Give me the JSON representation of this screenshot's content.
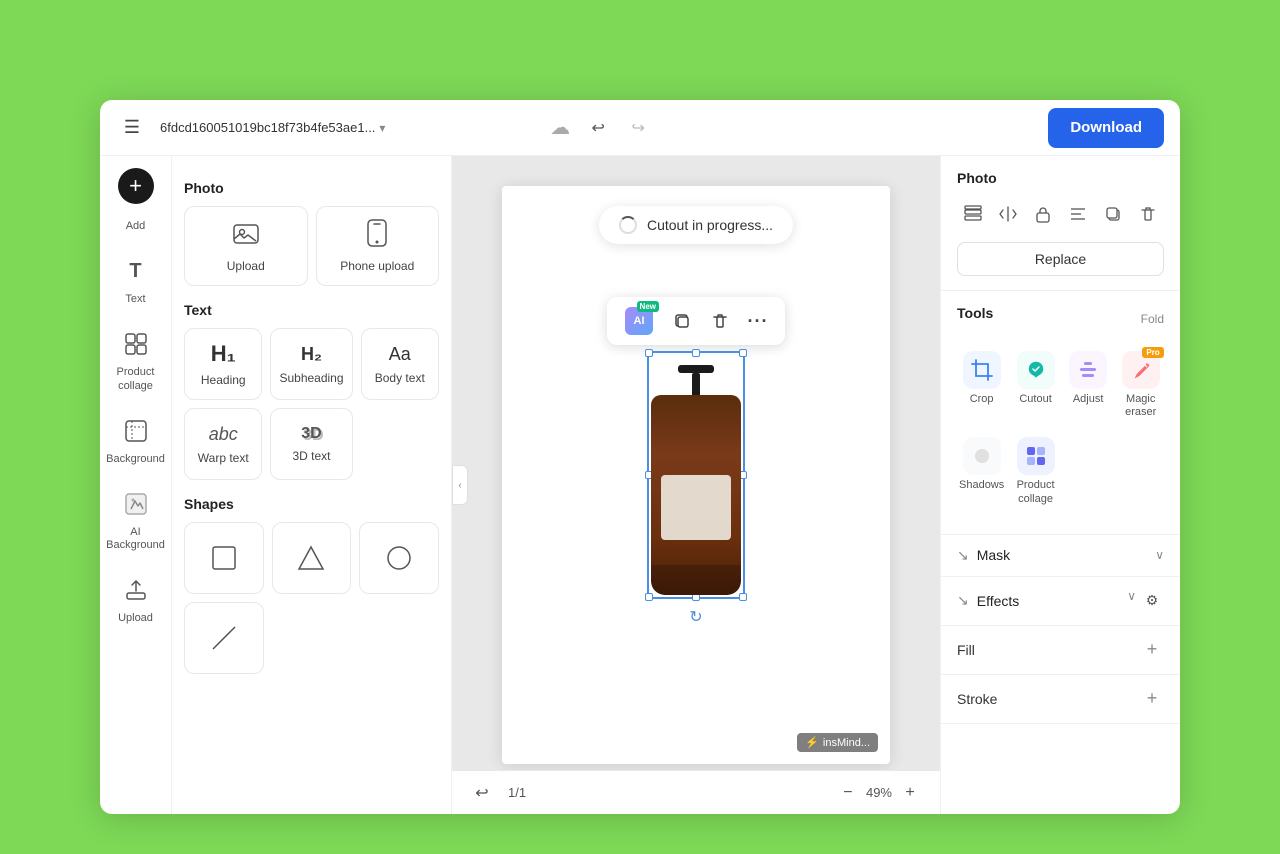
{
  "header": {
    "title": "6fdcd160051019bc18f73b4fe53ae1...",
    "download_label": "Download",
    "undo_icon": "↩",
    "redo_icon": "↪"
  },
  "cutout_badge": {
    "text": "Cutout in progress..."
  },
  "left_panel": {
    "add_label": "Add",
    "sections": {
      "photo": {
        "title": "Photo",
        "items": [
          {
            "id": "upload",
            "label": "Upload",
            "icon": "📷"
          },
          {
            "id": "phone-upload",
            "label": "Phone upload",
            "icon": "📱"
          }
        ]
      },
      "text": {
        "title": "Text",
        "items": [
          {
            "id": "heading",
            "label": "Heading",
            "type": "h1"
          },
          {
            "id": "subheading",
            "label": "Subheading",
            "type": "h2"
          },
          {
            "id": "body-text",
            "label": "Body text",
            "type": "aa"
          },
          {
            "id": "warp-text",
            "label": "Warp text",
            "type": "abc"
          },
          {
            "id": "3d-text",
            "label": "3D text",
            "type": "3d"
          }
        ]
      },
      "shapes": {
        "title": "Shapes",
        "items": [
          {
            "id": "rect",
            "label": "",
            "shape": "rect"
          },
          {
            "id": "tri",
            "label": "",
            "shape": "tri"
          },
          {
            "id": "circle",
            "label": "",
            "shape": "circle"
          },
          {
            "id": "line",
            "label": "",
            "shape": "line"
          }
        ]
      }
    }
  },
  "icon_sidebar": {
    "items": [
      {
        "id": "text",
        "label": "Text",
        "icon": "T"
      },
      {
        "id": "product-collage",
        "label": "Product collage",
        "icon": "⊞"
      },
      {
        "id": "background",
        "label": "Background",
        "icon": "▦"
      },
      {
        "id": "ai-background",
        "label": "AI Background",
        "icon": "✦"
      },
      {
        "id": "upload",
        "label": "Upload",
        "icon": "⬆"
      }
    ]
  },
  "right_sidebar": {
    "section_title": "Photo",
    "replace_label": "Replace",
    "tools_title": "Tools",
    "fold_label": "Fold",
    "tools": [
      {
        "id": "crop",
        "label": "Crop",
        "icon": "✂",
        "color": "blue"
      },
      {
        "id": "cutout",
        "label": "Cutout",
        "icon": "✦",
        "color": "teal"
      },
      {
        "id": "adjust",
        "label": "Adjust",
        "icon": "⊞",
        "color": "purple"
      },
      {
        "id": "magic-eraser",
        "label": "Magic eraser",
        "icon": "✧",
        "color": "red",
        "pro": true
      },
      {
        "id": "shadows",
        "label": "Shadows",
        "icon": "◑",
        "color": "gray"
      },
      {
        "id": "product-collage",
        "label": "Product collage",
        "icon": "⊟",
        "color": "indigo"
      }
    ],
    "mask_label": "Mask",
    "effects_label": "Effects",
    "fill_label": "Fill",
    "stroke_label": "Stroke"
  },
  "floating_toolbar": {
    "ai_label": "AI",
    "new_label": "New",
    "copy_icon": "⧉",
    "delete_icon": "🗑",
    "more_icon": "···"
  },
  "canvas": {
    "insmind_label": "insMind...",
    "page_indicator": "1/1",
    "zoom_value": "49%"
  }
}
